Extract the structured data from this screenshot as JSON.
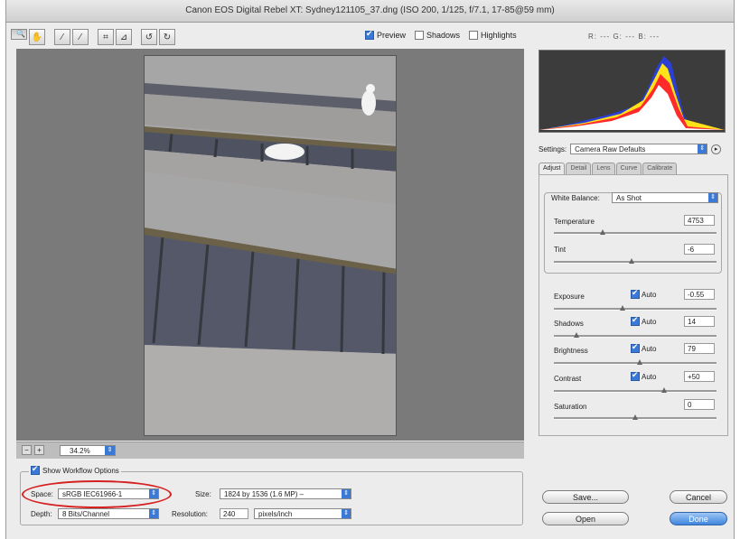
{
  "window": {
    "title": "Canon EOS Digital Rebel XT:  Sydney121105_37.dng  (ISO 200, 1/125, f/7.1, 17-85@59 mm)"
  },
  "toolbar": {
    "tools": [
      {
        "icon": "zoom-icon",
        "glyph": "🔍"
      },
      {
        "icon": "hand-icon",
        "glyph": "✋"
      },
      {
        "icon": "white-balance-icon",
        "glyph": "⁄"
      },
      {
        "icon": "color-sampler-icon",
        "glyph": "⁄"
      },
      {
        "icon": "crop-icon",
        "glyph": "⌗"
      },
      {
        "icon": "straighten-icon",
        "glyph": "⊿"
      },
      {
        "icon": "rotate-left-icon",
        "glyph": "↺"
      },
      {
        "icon": "rotate-right-icon",
        "glyph": "↻"
      }
    ],
    "preview_label": "Preview",
    "preview_checked": true,
    "shadows_label": "Shadows",
    "shadows_checked": false,
    "highlights_label": "Highlights",
    "highlights_checked": false
  },
  "rgb_readout": "R: ---  G: ---  B: ---",
  "zoom": {
    "value": "34.2%",
    "minus": "−",
    "plus": "+"
  },
  "settings": {
    "label": "Settings:",
    "value": "Camera Raw Defaults"
  },
  "tabs": [
    "Adjust",
    "Detail",
    "Lens",
    "Curve",
    "Calibrate"
  ],
  "white_balance": {
    "label": "White Balance:",
    "value": "As Shot",
    "temperature": {
      "label": "Temperature",
      "value": "4753",
      "position": 0.3
    },
    "tint": {
      "label": "Tint",
      "value": "-6",
      "position": 0.48
    }
  },
  "adjustments": [
    {
      "label": "Exposure",
      "auto_label": "Auto",
      "auto": true,
      "value": "-0.55",
      "position": 0.42
    },
    {
      "label": "Shadows",
      "auto_label": "Auto",
      "auto": true,
      "value": "14",
      "position": 0.14
    },
    {
      "label": "Brightness",
      "auto_label": "Auto",
      "auto": true,
      "value": "79",
      "position": 0.53
    },
    {
      "label": "Contrast",
      "auto_label": "Auto",
      "auto": true,
      "value": "+50",
      "position": 0.68
    },
    {
      "label": "Saturation",
      "auto_label": "",
      "auto": false,
      "value": "0",
      "position": 0.5
    }
  ],
  "workflow": {
    "show_label": "Show Workflow Options",
    "show_checked": true,
    "space_label": "Space:",
    "space_value": "sRGB IEC61966-1",
    "size_label": "Size:",
    "size_value": "1824 by 1536  (1.6 MP)  –",
    "depth_label": "Depth:",
    "depth_value": "8 Bits/Channel",
    "resolution_label": "Resolution:",
    "resolution_value": "240",
    "resolution_unit": "pixels/inch"
  },
  "buttons": {
    "save": "Save...",
    "cancel": "Cancel",
    "open": "Open",
    "done": "Done"
  },
  "colors": {
    "accent": "#3a79d6",
    "highlight_ring": "#d61f1f"
  }
}
